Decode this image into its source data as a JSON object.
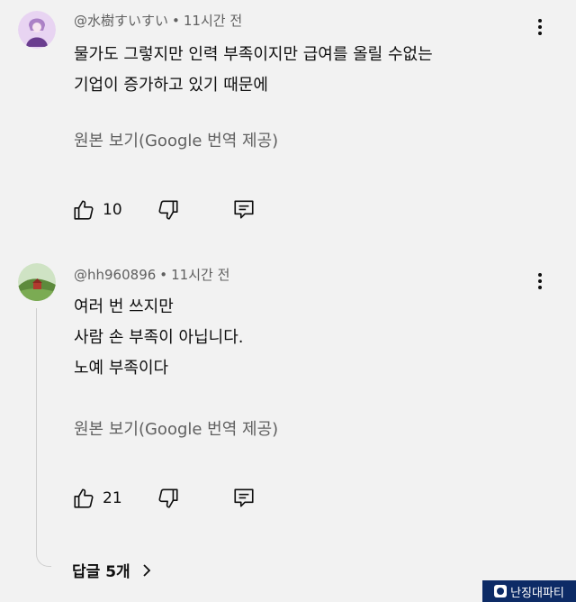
{
  "comments": [
    {
      "author": "@水樹すいすい",
      "time": "11시간 전",
      "lines": [
        "물가도 그렇지만 인력 부족이지만 급여를 올릴 수없는",
        "기업이 증가하고 있기 때문에"
      ],
      "translate_label": "원본 보기(Google 번역 제공)",
      "likes": "10",
      "colors": {
        "avatar_bg": "#e8d4f2",
        "avatar_figure": "#6a3d8f"
      }
    },
    {
      "author": "@hh960896",
      "time": "11시간 전",
      "lines": [
        "여러 번 쓰지만",
        "사람 손 부족이 아닙니다.",
        "노예 부족이다"
      ],
      "translate_label": "원본 보기(Google 번역 제공)",
      "likes": "21",
      "replies_label": "답글 5개",
      "colors": {
        "avatar_sky": "#cfe3c4",
        "avatar_hill": "#5d8a3c"
      }
    }
  ],
  "separator": "•",
  "watermark": "난징대파티",
  "icons": {
    "more": "more-vert-icon",
    "like": "thumb-up-icon",
    "dislike": "thumb-down-icon",
    "reply": "reply-comment-icon",
    "chevron": "chevron-right-icon"
  }
}
